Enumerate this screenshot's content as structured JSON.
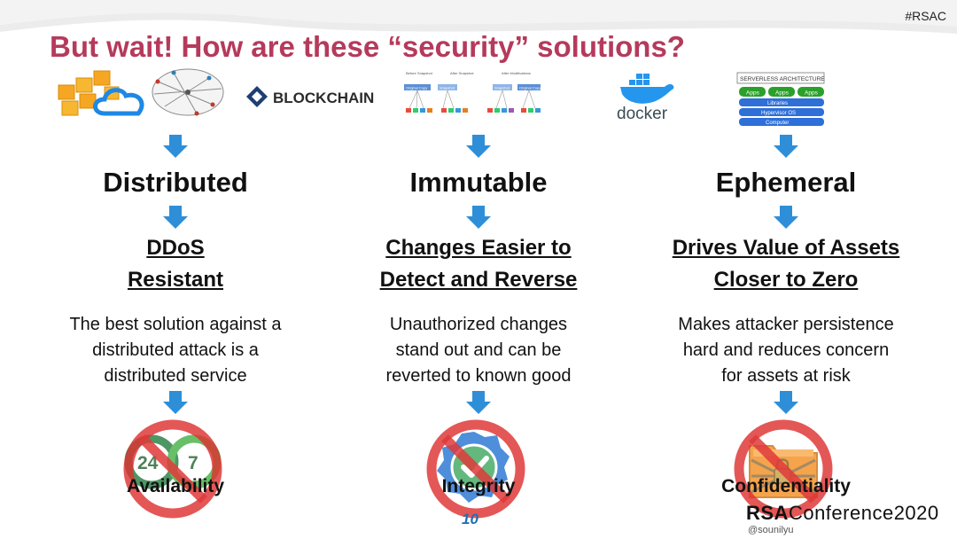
{
  "header": {
    "tag": "#RSAC",
    "title": "But wait! How are these “security” solutions?"
  },
  "logos": {
    "blockchain": "BLOCKCHAIN",
    "docker": "docker",
    "serverless": {
      "title": "SERVERLESS ARCHITECTURE",
      "apps": [
        "Apps",
        "Apps",
        "Apps"
      ],
      "layers": [
        "Libraries",
        "Hypervisor OS",
        "Computer"
      ]
    },
    "snapshots": {
      "headers": [
        "Before Snapshot",
        "After Snapshot",
        "After Modifications"
      ],
      "boxes": [
        "Original Copy",
        "Snapshot",
        "Snapshot",
        "Original Copy"
      ]
    },
    "icon_names": [
      "aws-cubes-icon",
      "azure-cloud-icon",
      "network-globe-icon",
      "blockchain-icon",
      "snapshot-diagram-icon",
      "docker-whale-icon",
      "serverless-stack-icon"
    ]
  },
  "columns": [
    {
      "concept": "Distributed",
      "benefit_line1": "DDoS",
      "benefit_line2": "Resistant",
      "desc_line1": "The best solution against a",
      "desc_line2": "distributed attack is a",
      "desc_line3": "distributed service",
      "property": "Availability",
      "icon": "24-7-infinity-icon"
    },
    {
      "concept": "Immutable",
      "benefit_line1": "Changes Easier to",
      "benefit_line2": "Detect and Reverse",
      "desc_line1": "Unauthorized changes",
      "desc_line2": "stand out and can be",
      "desc_line3": "reverted to known good",
      "property": "Integrity",
      "icon": "verified-badge-icon"
    },
    {
      "concept": "Ephemeral",
      "benefit_line1": "Drives Value of Assets",
      "benefit_line2": "Closer to Zero",
      "desc_line1": "Makes attacker persistence",
      "desc_line2": "hard and reduces concern",
      "desc_line3": "for assets at risk",
      "property": "Confidentiality",
      "icon": "locked-folder-icon"
    }
  ],
  "badge_24": "24",
  "badge_7": "7",
  "footer": {
    "page_number": "10",
    "conference_rsa": "RSA",
    "conference_rest": "Conference2020",
    "handle": "@sounilyu"
  },
  "colors": {
    "title": "#b53a5b",
    "arrow": "#2e8fd8",
    "prohibit": "#e03a3a",
    "page_number": "#1f6fb8"
  }
}
